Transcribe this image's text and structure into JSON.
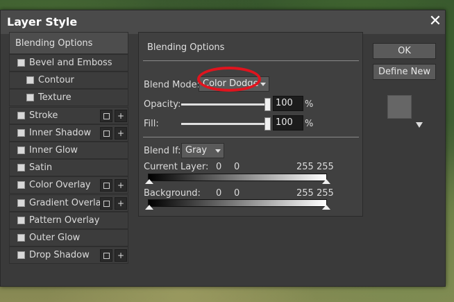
{
  "window": {
    "title": "Layer Style",
    "close_label": "✕"
  },
  "sidebar": {
    "header": "Blending Options",
    "items": [
      {
        "label": "Bevel and Emboss",
        "indent": false,
        "buttons": false
      },
      {
        "label": "Contour",
        "indent": true,
        "buttons": false
      },
      {
        "label": "Texture",
        "indent": true,
        "buttons": false
      },
      {
        "label": "Stroke",
        "indent": false,
        "buttons": true
      },
      {
        "label": "Inner Shadow",
        "indent": false,
        "buttons": true
      },
      {
        "label": "Inner Glow",
        "indent": false,
        "buttons": false
      },
      {
        "label": "Satin",
        "indent": false,
        "buttons": false
      },
      {
        "label": "Color Overlay",
        "indent": false,
        "buttons": true
      },
      {
        "label": "Gradient Overlay",
        "indent": false,
        "buttons": true
      },
      {
        "label": "Pattern Overlay",
        "indent": false,
        "buttons": false
      },
      {
        "label": "Outer Glow",
        "indent": false,
        "buttons": false
      },
      {
        "label": "Drop Shadow",
        "indent": false,
        "buttons": true
      }
    ],
    "add_button_label": "+"
  },
  "main": {
    "section_title": "Blending Options",
    "blend_mode": {
      "label": "Blend Mode:",
      "value": "Color Dodge"
    },
    "opacity": {
      "label": "Opacity:",
      "value": "100",
      "unit": "%",
      "level": 1.0
    },
    "fill": {
      "label": "Fill:",
      "value": "100",
      "unit": "%",
      "level": 1.0
    },
    "blend_if": {
      "label": "Blend If:",
      "value": "Gray"
    },
    "current_layer": {
      "label": "Current Layer:",
      "v1": "0",
      "v2": "0",
      "v3": "255 255"
    },
    "background": {
      "label": "Background:",
      "v1": "0",
      "v2": "0",
      "v3": "255 255"
    }
  },
  "buttons": {
    "ok": "OK",
    "define_new": "Define New"
  },
  "colors": {
    "highlight": "#e0141e",
    "dialog_bg": "#3a3a3a"
  }
}
